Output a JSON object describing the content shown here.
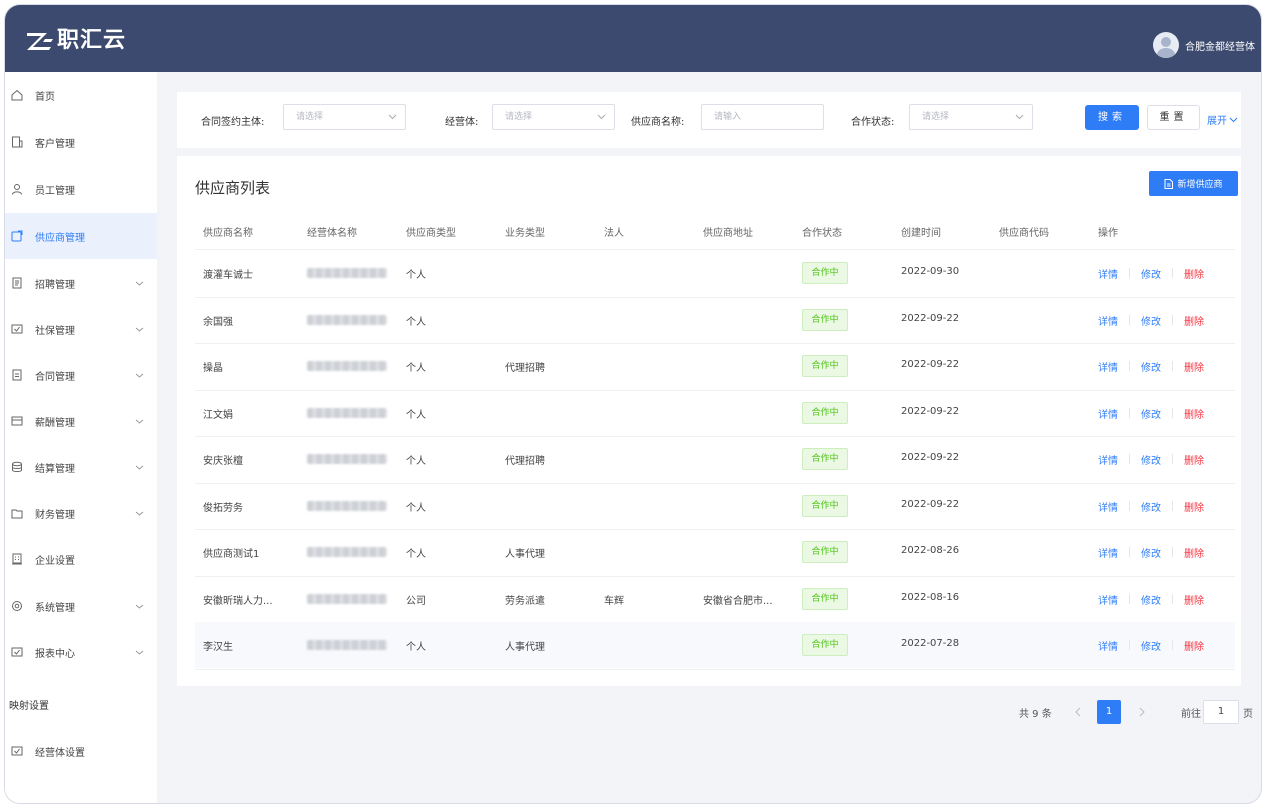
{
  "header": {
    "brand": "职汇云",
    "user_name": "合肥金都经营体"
  },
  "sidebar": {
    "items": [
      {
        "label": "首页",
        "icon": "home-icon",
        "expandable": false,
        "active": false
      },
      {
        "label": "客户管理",
        "icon": "customer-icon",
        "expandable": false,
        "active": false
      },
      {
        "label": "员工管理",
        "icon": "user-icon",
        "expandable": false,
        "active": false
      },
      {
        "label": "供应商管理",
        "icon": "supplier-icon",
        "expandable": false,
        "active": true
      },
      {
        "label": "招聘管理",
        "icon": "recruit-icon",
        "expandable": true,
        "active": false
      },
      {
        "label": "社保管理",
        "icon": "insurance-icon",
        "expandable": true,
        "active": false
      },
      {
        "label": "合同管理",
        "icon": "contract-icon",
        "expandable": true,
        "active": false
      },
      {
        "label": "薪酬管理",
        "icon": "salary-icon",
        "expandable": true,
        "active": false
      },
      {
        "label": "结算管理",
        "icon": "settlement-icon",
        "expandable": true,
        "active": false
      },
      {
        "label": "财务管理",
        "icon": "finance-icon",
        "expandable": true,
        "active": false
      },
      {
        "label": "企业设置",
        "icon": "enterprise-icon",
        "expandable": false,
        "active": false
      },
      {
        "label": "系统管理",
        "icon": "system-icon",
        "expandable": true,
        "active": false
      },
      {
        "label": "报表中心",
        "icon": "report-icon",
        "expandable": true,
        "active": false
      }
    ],
    "section_label": "映射设置",
    "section_items": [
      {
        "label": "经营体设置",
        "icon": "org-settings-icon"
      }
    ]
  },
  "filters": {
    "contract_entity_label": "合同签约主体:",
    "contract_entity_placeholder": "请选择",
    "operator_label": "经营体:",
    "operator_placeholder": "请选择",
    "supplier_name_label": "供应商名称:",
    "supplier_name_placeholder": "请输入",
    "status_label": "合作状态:",
    "status_placeholder": "请选择",
    "search_label": "搜索",
    "reset_label": "重置",
    "expand_label": "展开"
  },
  "table": {
    "title": "供应商列表",
    "add_label": "新增供应商",
    "columns": [
      "供应商名称",
      "经营体名称",
      "供应商类型",
      "业务类型",
      "法人",
      "供应商地址",
      "合作状态",
      "创建时间",
      "供应商代码",
      "操作"
    ],
    "rows": [
      {
        "name": "渡灌车诚士",
        "type": "个人",
        "business": "",
        "legal": "",
        "address": "",
        "status": "合作中",
        "created": "2022-09-30",
        "code": ""
      },
      {
        "name": "余国强",
        "type": "个人",
        "business": "",
        "legal": "",
        "address": "",
        "status": "合作中",
        "created": "2022-09-22",
        "code": ""
      },
      {
        "name": "操晶",
        "type": "个人",
        "business": "代理招聘",
        "legal": "",
        "address": "",
        "status": "合作中",
        "created": "2022-09-22",
        "code": ""
      },
      {
        "name": "江文娟",
        "type": "个人",
        "business": "",
        "legal": "",
        "address": "",
        "status": "合作中",
        "created": "2022-09-22",
        "code": ""
      },
      {
        "name": "安庆张檀",
        "type": "个人",
        "business": "代理招聘",
        "legal": "",
        "address": "",
        "status": "合作中",
        "created": "2022-09-22",
        "code": ""
      },
      {
        "name": "俊拓劳务",
        "type": "个人",
        "business": "",
        "legal": "",
        "address": "",
        "status": "合作中",
        "created": "2022-09-22",
        "code": ""
      },
      {
        "name": "供应商测试1",
        "type": "个人",
        "business": "人事代理",
        "legal": "",
        "address": "",
        "status": "合作中",
        "created": "2022-08-26",
        "code": ""
      },
      {
        "name": "安徽昕瑞人力...",
        "type": "公司",
        "business": "劳务派遣",
        "legal": "车辉",
        "address": "安徽省合肥市...",
        "status": "合作中",
        "created": "2022-08-16",
        "code": ""
      },
      {
        "name": "李汉生",
        "type": "个人",
        "business": "人事代理",
        "legal": "",
        "address": "",
        "status": "合作中",
        "created": "2022-07-28",
        "code": ""
      }
    ],
    "actions": {
      "detail": "详情",
      "edit": "修改",
      "delete": "删除"
    }
  },
  "pagination": {
    "total_text": "共 9 条",
    "current_page": "1",
    "goto_label": "前往",
    "goto_value": "1",
    "page_unit": "页"
  },
  "colors": {
    "header_bg": "#3b4a6e",
    "primary": "#2f7df6",
    "danger": "#f5333f",
    "success": "#52c41a"
  }
}
